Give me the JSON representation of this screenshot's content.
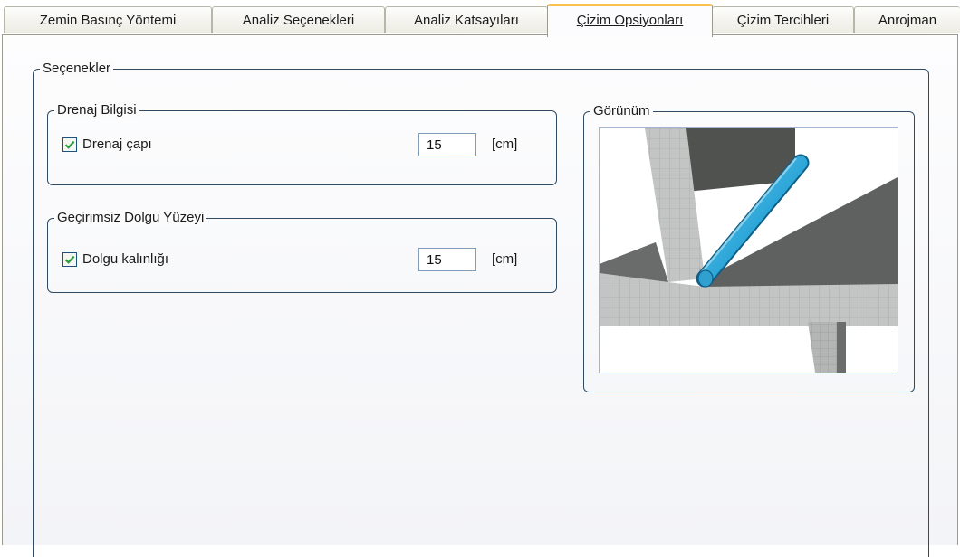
{
  "tabs": [
    {
      "label": "Zemin Basınç Yöntemi",
      "active": false
    },
    {
      "label": "Analiz Seçenekleri",
      "active": false
    },
    {
      "label": "Analiz Katsayıları",
      "active": false
    },
    {
      "label": "Çizim Opsiyonları",
      "active": true
    },
    {
      "label": "Çizim Tercihleri",
      "active": false
    },
    {
      "label": "Anrojman",
      "active": false
    }
  ],
  "options_group": {
    "title": "Seçenekler"
  },
  "drainage": {
    "title": "Drenaj Bilgisi",
    "checkbox_label": "Drenaj çapı",
    "checked": true,
    "value": "15",
    "unit": "[cm]"
  },
  "fill": {
    "title": "Geçirimsiz Dolgu Yüzeyi",
    "checkbox_label": "Dolgu kalınlığı",
    "checked": true,
    "value": "15",
    "unit": "[cm]"
  },
  "preview": {
    "title": "Görünüm"
  },
  "colors": {
    "group_border": "#2f4a62",
    "active_tab_accent": "#f6c350",
    "check_mark": "#2a9a3a",
    "drain_pipe": "#2ca6d8"
  }
}
